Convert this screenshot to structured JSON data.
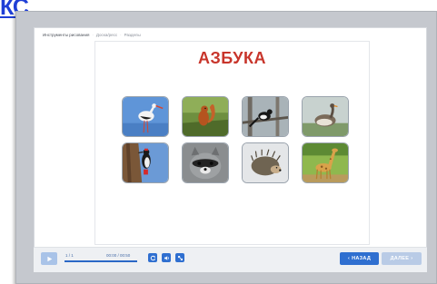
{
  "corner_link": "КС",
  "breadcrumb": {
    "items": [
      "Инструменты рисования",
      "Доска/ресс",
      "Разделы"
    ],
    "separator": "·"
  },
  "slide": {
    "title": "АЗБУКА",
    "images": [
      {
        "name": "stork"
      },
      {
        "name": "squirrel"
      },
      {
        "name": "magpie"
      },
      {
        "name": "goose"
      },
      {
        "name": "woodpecker"
      },
      {
        "name": "raccoon"
      },
      {
        "name": "hedgehog"
      },
      {
        "name": "giraffe"
      }
    ]
  },
  "player": {
    "counter": "1 / 1",
    "time": "00:00 / 00:50",
    "progress": 1.0,
    "play_icon": "play-icon",
    "reload_icon": "reload-icon",
    "volume_icon": "volume-icon",
    "fullscreen_icon": "fullscreen-icon",
    "back_label": "НАЗАД",
    "next_label": "ДАЛЕЕ"
  },
  "colors": {
    "accent": "#2f6fd0",
    "title": "#c8352b",
    "disabled": "#b9cbe6"
  }
}
